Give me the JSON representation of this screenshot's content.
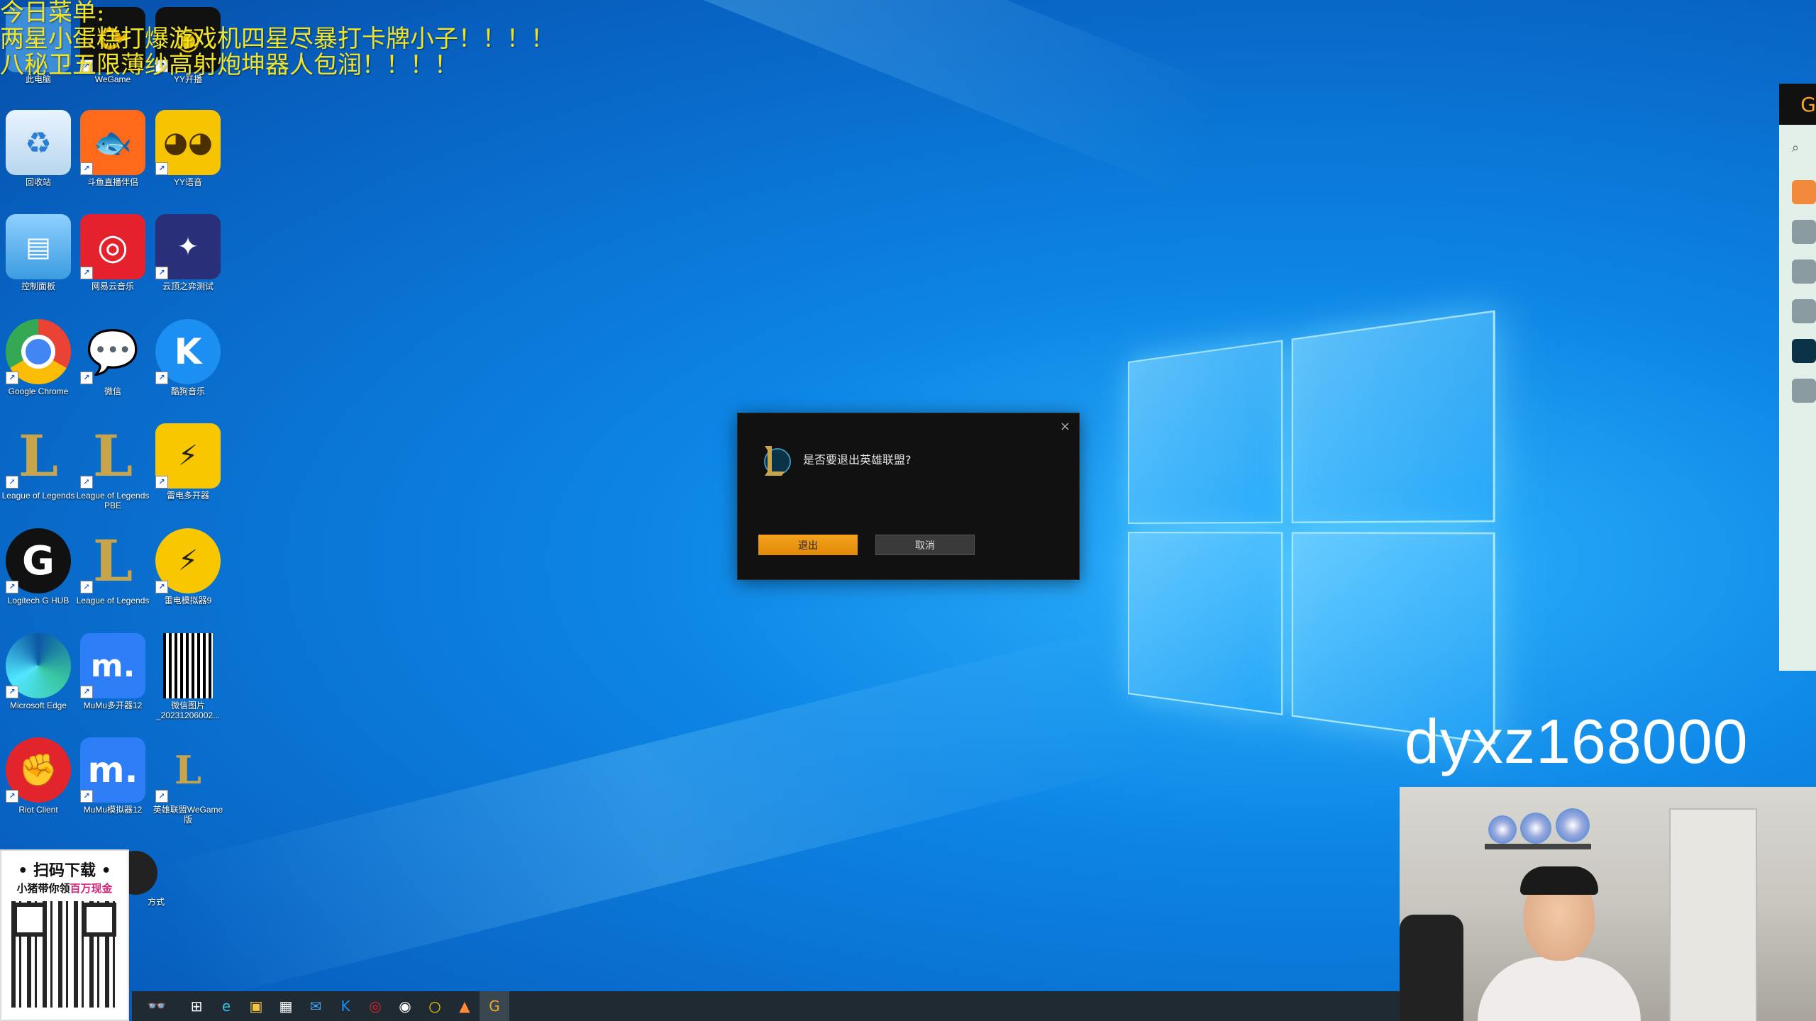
{
  "menu": {
    "line1": "今日菜单:",
    "line2": "两星小蛋糕打爆游戏机四星尽暴打卡牌小子！！！！",
    "line3": "八秘卫五限薄纱高射炮坤器人包润！！！！"
  },
  "desktop_icons": [
    {
      "label": "此电脑",
      "icon": "computer-icon"
    },
    {
      "label": "WeGame",
      "icon": "wegame-icon"
    },
    {
      "label": "YY开播",
      "icon": "yy-live-icon"
    },
    {
      "label": "回收站",
      "icon": "recycle-bin-icon"
    },
    {
      "label": "斗鱼直播伴侣",
      "icon": "douyu-icon"
    },
    {
      "label": "YY语音",
      "icon": "yy-voice-icon"
    },
    {
      "label": "控制面板",
      "icon": "control-panel-icon"
    },
    {
      "label": "网易云音乐",
      "icon": "netease-music-icon"
    },
    {
      "label": "云顶之弈测试",
      "icon": "tft-icon"
    },
    {
      "label": "Google Chrome",
      "icon": "chrome-icon"
    },
    {
      "label": "微信",
      "icon": "wechat-icon"
    },
    {
      "label": "酷狗音乐",
      "icon": "kugou-icon"
    },
    {
      "label": "League of Legends",
      "icon": "lol-icon"
    },
    {
      "label": "League of Legends PBE",
      "icon": "lol-pbe-icon"
    },
    {
      "label": "雷电多开器",
      "icon": "ldplayer-multi-icon"
    },
    {
      "label": "Logitech G HUB",
      "icon": "logitech-icon"
    },
    {
      "label": "League of Legends",
      "icon": "lol-icon"
    },
    {
      "label": "雷电模拟器9",
      "icon": "ldplayer-icon"
    },
    {
      "label": "Microsoft Edge",
      "icon": "edge-icon"
    },
    {
      "label": "MuMu多开器12",
      "icon": "mumu-multi-icon"
    },
    {
      "label": "微信图片_20231206002...",
      "icon": "qr-image-icon"
    },
    {
      "label": "Riot Client",
      "icon": "riot-icon"
    },
    {
      "label": "MuMu模拟器12",
      "icon": "mumu-icon"
    },
    {
      "label": "英雄联盟WeGame版",
      "icon": "lol-wegame-icon"
    }
  ],
  "extra_icon_label": "方式",
  "dialog": {
    "message": "是否要退出英雄联盟?",
    "confirm_label": "退出",
    "cancel_label": "取消",
    "close_glyph": "×"
  },
  "watermark": "dyxz168000",
  "qr_ad": {
    "title": "• 扫码下载 •",
    "subtitle_prefix": "小猪带你领",
    "subtitle_highlight": "百万现金"
  },
  "taskbar": [
    {
      "icon": "task-view-icon",
      "glyph": "⊞"
    },
    {
      "icon": "edge-icon",
      "glyph": "e"
    },
    {
      "icon": "file-explorer-icon",
      "glyph": "▣"
    },
    {
      "icon": "store-icon",
      "glyph": "▦"
    },
    {
      "icon": "mail-icon",
      "glyph": "✉"
    },
    {
      "icon": "kugou-icon",
      "glyph": "K"
    },
    {
      "icon": "netease-music-icon",
      "glyph": "◎"
    },
    {
      "icon": "obs-icon",
      "glyph": "◉"
    },
    {
      "icon": "wegame-icon",
      "glyph": "○"
    },
    {
      "icon": "douyu-icon",
      "glyph": "▲"
    },
    {
      "icon": "logitech-icon",
      "glyph": "G"
    }
  ]
}
